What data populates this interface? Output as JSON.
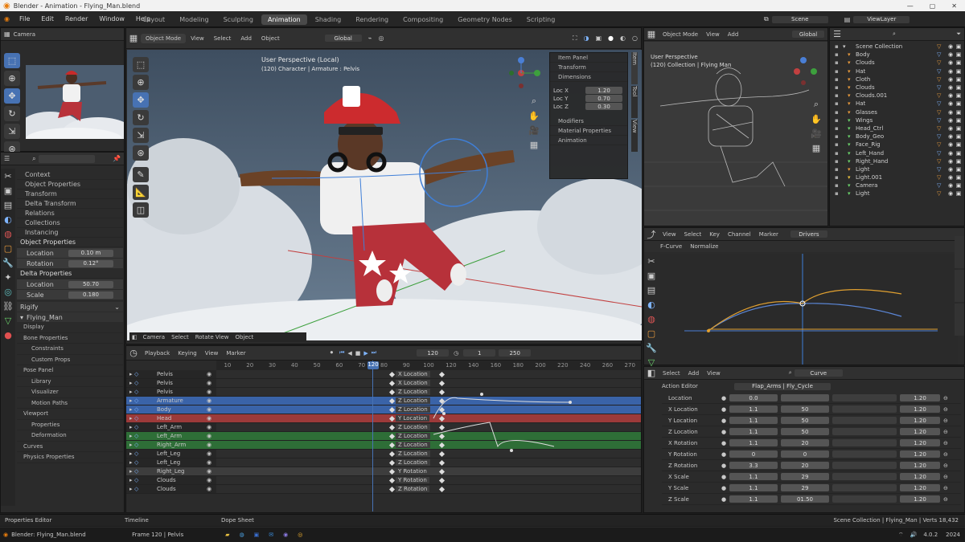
{
  "titlebar": {
    "title": "Blender - Animation - Flying_Man.blend",
    "controls": [
      "—",
      "▢",
      "✕"
    ]
  },
  "menu": [
    "File",
    "Edit",
    "Render",
    "Window",
    "Help"
  ],
  "workspaces": [
    "Layout",
    "Modeling",
    "Sculpting",
    "Animation",
    "Shading",
    "Rendering",
    "Compositing",
    "Geometry Nodes",
    "Scripting"
  ],
  "active_workspace": "Animation",
  "topright": {
    "scene": "Scene",
    "view_layer": "ViewLayer"
  },
  "main_viewport": {
    "title": "User Perspective (Local)",
    "subtitle": "(120) Character | Armature : Pelvis",
    "header": [
      "Object Mode",
      "View",
      "Select",
      "Add",
      "Object"
    ],
    "orientation": "Global",
    "footer": [
      "Camera",
      "Select",
      "Rotate View",
      "Object"
    ]
  },
  "n_panel": {
    "tabs": [
      "Item",
      "Tool",
      "View"
    ],
    "rows": [
      "Item Panel",
      "Transform",
      "Dimensions"
    ],
    "fields": [
      [
        "Loc X",
        "1.20"
      ],
      [
        "Loc Y",
        "0.70"
      ],
      [
        "Loc Z",
        "0.30"
      ]
    ],
    "sections": [
      "Modifiers",
      "Material Properties",
      "Animation"
    ]
  },
  "properties": {
    "search": "",
    "sections": [
      "Context",
      "Object Properties",
      "Transform",
      "Delta Transform",
      "Relations",
      "Collections",
      "Instancing"
    ],
    "sub": "Object Properties",
    "fields": [
      [
        "Location",
        "0.10 m"
      ],
      [
        "Rotation",
        "0.12°"
      ]
    ],
    "sub2": "Delta Properties",
    "fields2": [
      [
        "Location",
        "50.70"
      ],
      [
        "Scale",
        "0.180"
      ]
    ],
    "rig": "Rigify",
    "rig_name": "Flying_Man",
    "tree": [
      "Display",
      "Bone Properties",
      "Constraints",
      "Custom Props",
      "Pose Panel",
      "Library",
      "Visualizer",
      "Motion Paths",
      "Viewport",
      "Properties",
      "Deformation",
      "Curves",
      "Physics Properties"
    ]
  },
  "camera_view": {
    "label": "Camera"
  },
  "right_viewport": {
    "title": "User Perspective",
    "subtitle": "(120) Collection | Flying Man",
    "header": [
      "Object Mode",
      "View",
      "Add"
    ],
    "shading": "Global"
  },
  "outliner": {
    "title": "Scene Collection",
    "items": [
      "Scene Collection",
      "Body",
      "Clouds",
      "Hat",
      "Cloth",
      "Clouds",
      "Clouds.001",
      "Hat",
      "Glasses",
      "Wings",
      "Head_Ctrl",
      "Body_Geo",
      "Face_Rig",
      "Left_Hand",
      "Right_Hand",
      "Light",
      "Light.001",
      "Camera",
      "Light"
    ]
  },
  "graph_editor": {
    "header": [
      "View",
      "Select",
      "Key",
      "Channel",
      "Marker",
      "View"
    ],
    "title": "F-Curve",
    "mode": "Drivers",
    "submode": "Normalize"
  },
  "drivers": {
    "header": [
      "Select",
      "Add",
      "View"
    ],
    "search": "Curve",
    "title": "Action Editor",
    "action": "Flap_Arms | Fly_Cycle",
    "rows": [
      {
        "label": "Location",
        "a": "0.0",
        "b": "",
        "c": "",
        "v": "1.20"
      },
      {
        "label": "X Location",
        "a": "1.1",
        "b": "50",
        "c": "",
        "v": "1.20"
      },
      {
        "label": "Y Location",
        "a": "1.1",
        "b": "50",
        "c": "",
        "v": "1.20"
      },
      {
        "label": "Z Location",
        "a": "1.1",
        "b": "50",
        "c": "",
        "v": "1.20"
      },
      {
        "label": "X Rotation",
        "a": "1.1",
        "b": "20",
        "c": "",
        "v": "1.20"
      },
      {
        "label": "Y Rotation",
        "a": "0",
        "b": "0",
        "c": "",
        "v": "1.20"
      },
      {
        "label": "Z Rotation",
        "a": "3.3",
        "b": "20",
        "c": "",
        "v": "1.20"
      },
      {
        "label": "X Scale",
        "a": "1.1",
        "b": "29",
        "c": "",
        "v": "1.20"
      },
      {
        "label": "Y Scale",
        "a": "1.1",
        "b": "29",
        "c": "",
        "v": "1.20"
      },
      {
        "label": "Z Scale",
        "a": "1.1",
        "b": "01.50",
        "c": "",
        "v": "1.20"
      }
    ]
  },
  "timeline": {
    "menu": [
      "Playback",
      "Keying",
      "View",
      "Marker"
    ],
    "current_frame": "120",
    "start": "1",
    "end": "250",
    "ruler": [
      "10",
      "20",
      "30",
      "40",
      "50",
      "60",
      "70",
      "80",
      "90",
      "100",
      "120",
      "140",
      "160",
      "180",
      "200",
      "220",
      "240",
      "260",
      "270"
    ],
    "channels": [
      {
        "name": "Pelvis",
        "key": "X Location",
        "color": "#2d2d2d"
      },
      {
        "name": "Pelvis",
        "key": "X Location",
        "color": "#2d2d2d"
      },
      {
        "name": "Pelvis",
        "key": "Z Location",
        "color": "#2d2d2d"
      },
      {
        "name": "Armature",
        "key": "Z Location",
        "color": "#3a63a8"
      },
      {
        "name": "Body",
        "key": "Z Location",
        "color": "#3a63a8"
      },
      {
        "name": "Head",
        "key": "Y Location",
        "color": "#9c3a3a"
      },
      {
        "name": "Left_Arm",
        "key": "Z Location",
        "color": "#2d2d2d"
      },
      {
        "name": "Left_Arm",
        "key": "Z Location",
        "color": "#2e6e37"
      },
      {
        "name": "Right_Arm",
        "key": "Z Location",
        "color": "#2e6e37"
      },
      {
        "name": "Left_Leg",
        "key": "Z Location",
        "color": "#2d2d2d"
      },
      {
        "name": "Left_Leg",
        "key": "Z Location",
        "color": "#2d2d2d"
      },
      {
        "name": "Right_Leg",
        "key": "Y Rotation",
        "color": "#3d3d3d"
      },
      {
        "name": "Clouds",
        "key": "Y Rotation",
        "color": "#2d2d2d"
      },
      {
        "name": "Clouds",
        "key": "Z Rotation",
        "color": "#2d2d2d"
      }
    ]
  },
  "statusbar": {
    "left": "Properties Editor",
    "mid": "Timeline",
    "mid2": "Dope Sheet",
    "right": "Scene Collection | Flying_Man | Verts 18,432",
    "time": "4.0.2",
    "date": "2024"
  },
  "taskbar": {
    "left": "Blender: Flying_Man.blend",
    "mid": "Frame 120 | Pelvis"
  },
  "colors": {
    "accent": "#4772b3",
    "blue_curve": "#5b86d6",
    "orange_curve": "#e0a030",
    "red_row": "#9c3a3a",
    "green_row": "#2e6e37"
  }
}
